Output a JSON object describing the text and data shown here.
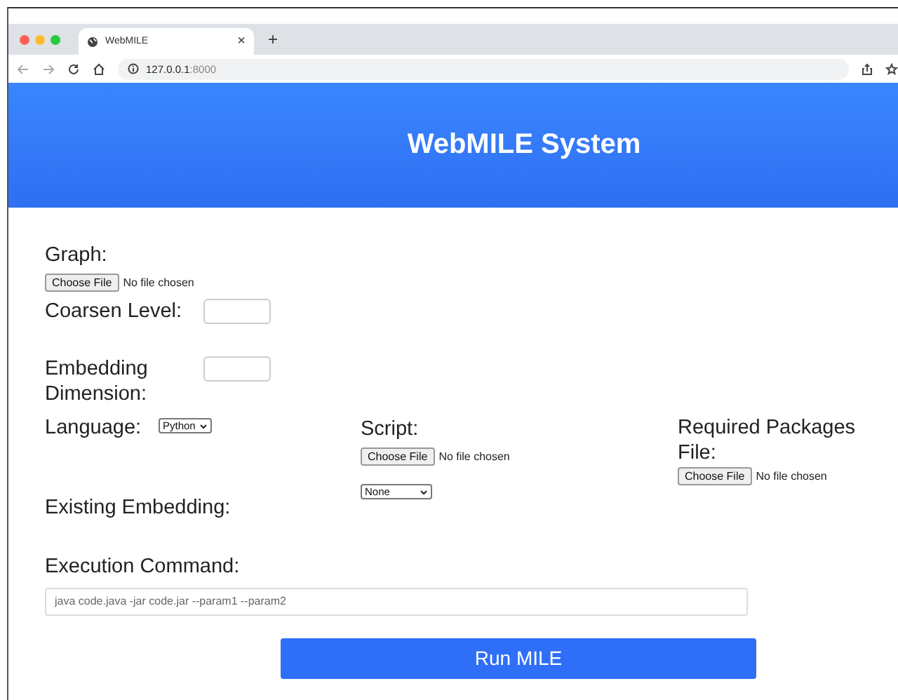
{
  "browser": {
    "tab": {
      "title": "WebMILE",
      "close": "×"
    },
    "new_tab": "+",
    "address": {
      "host": "127.0.0.1",
      "port": ":8000"
    }
  },
  "header": {
    "title": "WebMILE System"
  },
  "form": {
    "graph": {
      "label": "Graph:",
      "button": "Choose File",
      "status": "No file chosen"
    },
    "coarsen_level": {
      "label": "Coarsen Level:"
    },
    "embedding_dimension": {
      "label": "Embedding Dimension:"
    },
    "language": {
      "label": "Language:",
      "value": "Python"
    },
    "script": {
      "label": "Script:",
      "button": "Choose File",
      "status": "No file chosen"
    },
    "required_packages": {
      "label": "Required Packages File:",
      "button": "Choose File",
      "status": "No file chosen"
    },
    "existing_embedding": {
      "label": "Existing Embedding:",
      "value": "None"
    },
    "execution_command": {
      "label": "Execution Command:",
      "placeholder": "java code.java -jar code.jar --param1 --param2"
    },
    "submit": "Run MILE"
  }
}
